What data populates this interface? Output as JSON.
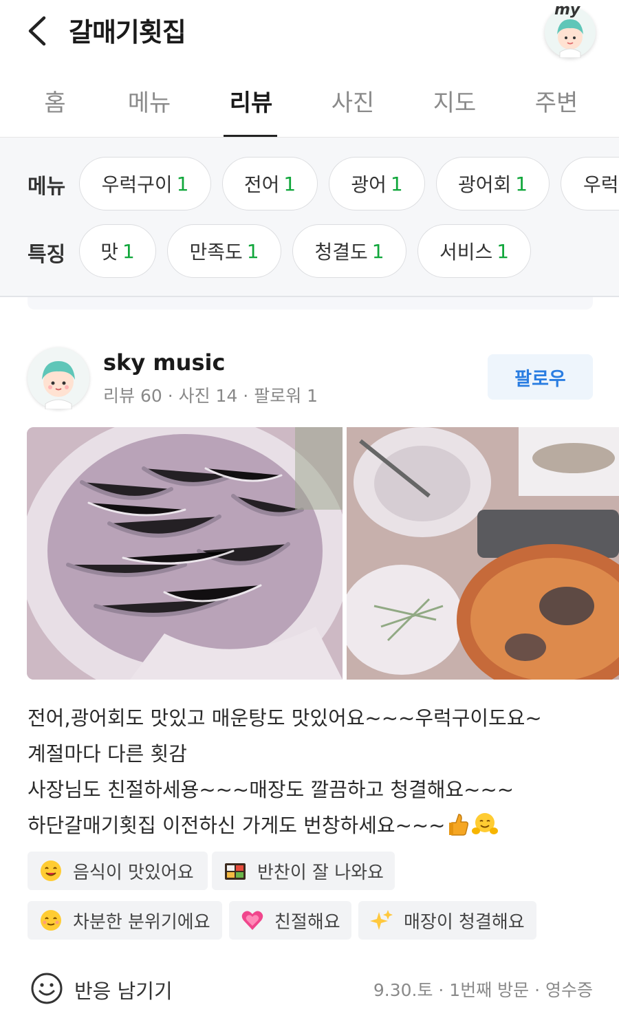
{
  "header": {
    "title": "갈매기횟집",
    "my_badge": "my"
  },
  "tabs": [
    {
      "label": "홈",
      "active": false
    },
    {
      "label": "메뉴",
      "active": false
    },
    {
      "label": "리뷰",
      "active": true
    },
    {
      "label": "사진",
      "active": false
    },
    {
      "label": "지도",
      "active": false
    },
    {
      "label": "주변",
      "active": false
    }
  ],
  "filters": {
    "menu_label": "메뉴",
    "menu_chips": [
      {
        "name": "우럭구이",
        "count": "1"
      },
      {
        "name": "전어",
        "count": "1"
      },
      {
        "name": "광어",
        "count": "1"
      },
      {
        "name": "광어회",
        "count": "1"
      },
      {
        "name": "우럭",
        "count": ""
      }
    ],
    "feature_label": "특징",
    "feature_chips": [
      {
        "name": "맛",
        "count": "1"
      },
      {
        "name": "만족도",
        "count": "1"
      },
      {
        "name": "청결도",
        "count": "1"
      },
      {
        "name": "서비스",
        "count": "1"
      }
    ]
  },
  "review": {
    "author": "sky music",
    "stats": "리뷰 60 · 사진 14 · 팔로워 1",
    "follow_label": "팔로우",
    "text_lines": [
      "전어,광어회도 맛있고 매운탕도 맛있어요~~~우럭구이도요~",
      "계절마다 다른 횟감",
      "사장님도 친절하세용~~~매장도 깔끔하고 청결해요~~~",
      "하단갈매기횟집 이전하신 가게도 번창하세요~~~"
    ],
    "tags": [
      {
        "label": "음식이 맛있어요",
        "icon": "yum-face-icon"
      },
      {
        "label": "반찬이 잘 나와요",
        "icon": "bento-icon"
      },
      {
        "label": "차분한 분위기에요",
        "icon": "calm-face-icon"
      },
      {
        "label": "친절해요",
        "icon": "heart-icon"
      },
      {
        "label": "매장이 청결해요",
        "icon": "sparkles-icon"
      }
    ],
    "react_label": "반응 남기기",
    "visit_meta": "9.30.토 · 1번째 방문 · 영수증"
  },
  "colors": {
    "count_green": "#0fa63a",
    "follow_blue": "#2a7de1"
  }
}
